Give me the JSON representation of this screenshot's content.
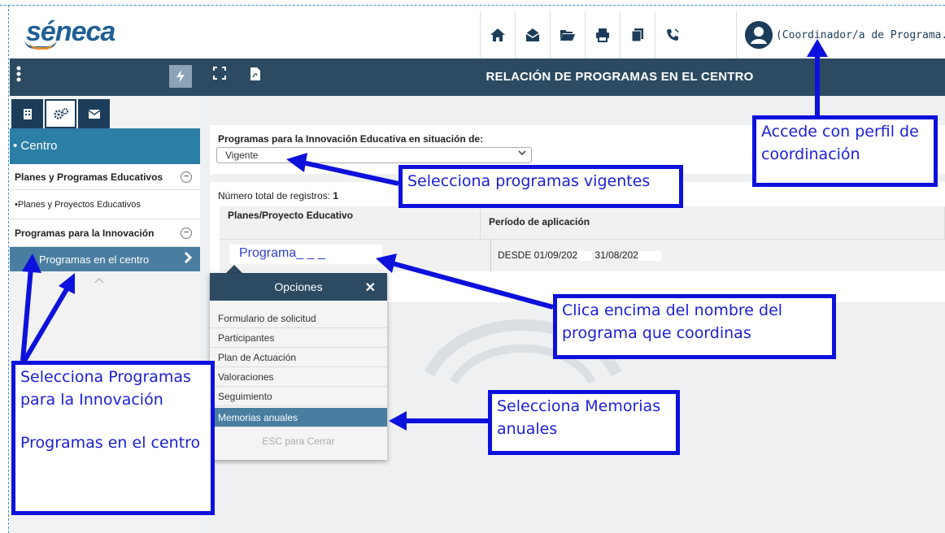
{
  "header": {
    "logo": "séneca",
    "user_label": "(Coordinador/a de Programa..."
  },
  "toolbar": {
    "page_title": "RELACIÓN DE PROGRAMAS EN EL CENTRO"
  },
  "sidebar": {
    "section": "• Centro",
    "items": [
      {
        "label": "Planes y Programas Educativos",
        "toggle": "−"
      },
      {
        "label": "•Planes y Proyectos Educativos"
      },
      {
        "label": "Programas para la Innovación",
        "toggle": "−"
      },
      {
        "label": "Programas en el centro"
      }
    ]
  },
  "filter": {
    "label": "Programas para la Innovación Educativa en situación de:",
    "value": "Vigente"
  },
  "results": {
    "count_label": "Número total de registros:",
    "count_value": "1",
    "columns": [
      "Planes/Proyecto Educativo",
      "Período de aplicación"
    ],
    "row": {
      "program": "Programa_ _ _",
      "period_a": "DESDE 01/09/202",
      "period_b": "31/08/202"
    }
  },
  "options_popup": {
    "title": "Opciones",
    "items": [
      "Formulario de solicitud",
      "Participantes",
      "Plan de Actuación",
      "Valoraciones",
      "Seguimiento",
      "Memorias anuales"
    ],
    "selected": "Memorias anuales",
    "footer": "ESC para Cerrar"
  },
  "annotations": {
    "profile": "Accede con perfil de coordinación",
    "vigentes": "Selecciona programas vigentes",
    "clica": "Clica encima del nombre del programa que coordinas",
    "memorias": "Selecciona Memorias anuales",
    "sidebar_a": "Selecciona Programas para la Innovación",
    "sidebar_b": "Programas en el centro"
  },
  "colors": {
    "annotation": "#0d11dc",
    "toolbar": "#2c4a61",
    "sidebar_section": "#2b7ea6",
    "selected": "#4a7ea1"
  },
  "icons": [
    "home-icon",
    "envelope-open-icon",
    "folder-open-icon",
    "print-icon",
    "copy-icon",
    "phone-icon",
    "user-avatar-icon",
    "kebab-menu-icon",
    "bolt-icon",
    "expand-icon",
    "pdf-icon",
    "building-icon",
    "cogs-icon",
    "mail-icon"
  ]
}
